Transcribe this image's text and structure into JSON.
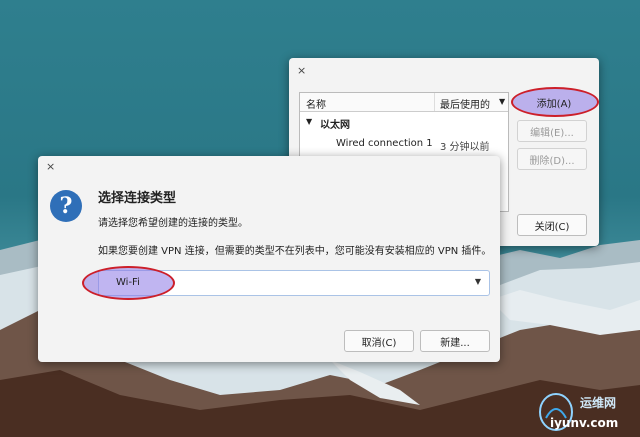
{
  "bg_window": {
    "close_glyph": "×",
    "col_name": "名称",
    "col_last_used": "最后使用的",
    "sort_arrow": "▼",
    "group_expander": "▼",
    "group_label": "以太网",
    "row_name": "Wired connection 1",
    "row_last_used": "3 分钟以前",
    "add_button": "添加(A)",
    "edit_button": "编辑(E)...",
    "delete_button": "删除(D)...",
    "close_button": "关闭(C)"
  },
  "dialog": {
    "close_glyph": "×",
    "question_glyph": "?",
    "title": "选择连接类型",
    "subtitle": "请选择您希望创建的连接的类型。",
    "description": "如果您要创建 VPN 连接，但需要的类型不在列表中，您可能没有安装相应的 VPN 插件。",
    "connection_type_value": "Wi-Fi",
    "dropdown_arrow": "▼",
    "cancel_button": "取消(C)",
    "create_button": "新建..."
  },
  "watermark": {
    "text": "运维网",
    "domain": "iyunv.com"
  },
  "colors": {
    "highlight_fill": "#8c78e6",
    "highlight_stroke": "#cc1f2a",
    "dialog_icon": "#2f6fb8"
  }
}
